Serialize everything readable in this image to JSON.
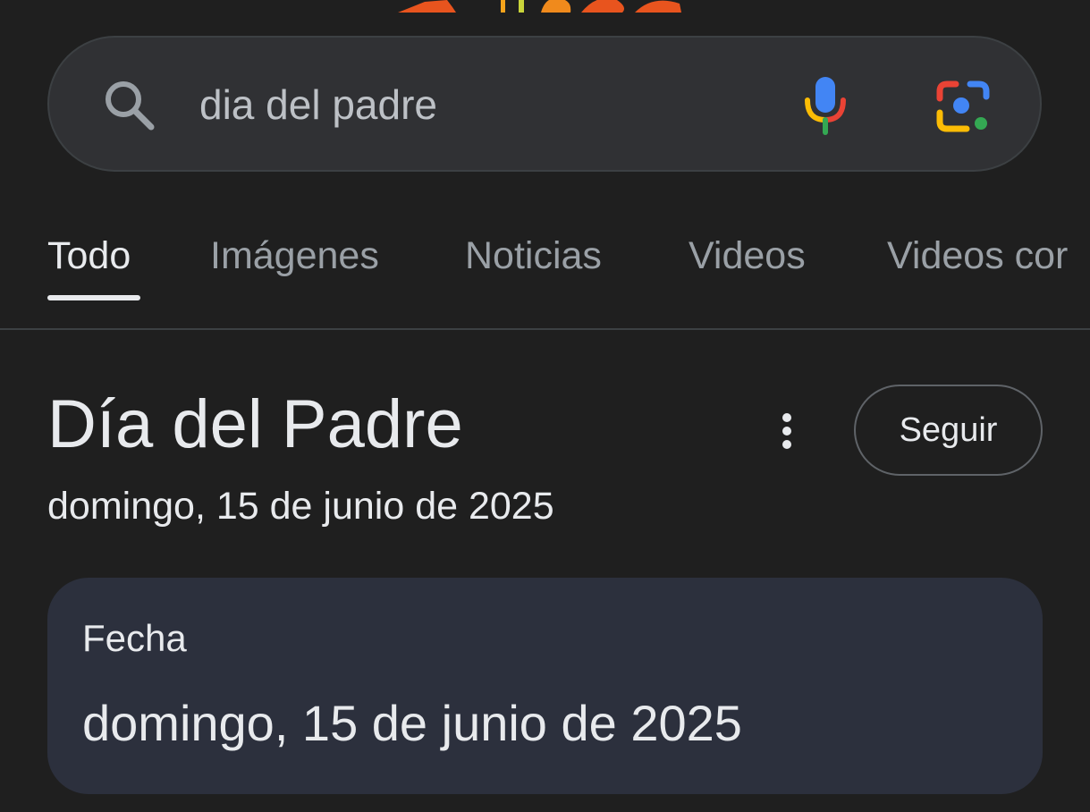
{
  "search": {
    "query": "dia del padre"
  },
  "tabs": [
    {
      "label": "Todo",
      "active": true
    },
    {
      "label": "Imágenes",
      "active": false
    },
    {
      "label": "Noticias",
      "active": false
    },
    {
      "label": "Videos",
      "active": false
    },
    {
      "label": "Videos cor",
      "active": false
    }
  ],
  "knowledge_panel": {
    "title": "Día del Padre",
    "follow_label": "Seguir",
    "subtitle": "domingo, 15 de junio de 2025"
  },
  "answer_card": {
    "label": "Fecha",
    "value": "domingo, 15 de junio de 2025"
  },
  "icons": {
    "search": "search-icon",
    "mic": "mic-icon",
    "lens": "lens-icon",
    "more": "more-vert-icon",
    "doodle": "doodle-logo"
  },
  "colors": {
    "background": "#1f1f1f",
    "search_bar": "#303134",
    "card": "#2c303d",
    "text_primary": "#e8eaed",
    "text_secondary": "#9aa0a6",
    "google_blue": "#4285f4",
    "google_red": "#ea4335",
    "google_yellow": "#fbbc05",
    "google_green": "#34a853",
    "doodle_orange": "#e8541e"
  }
}
